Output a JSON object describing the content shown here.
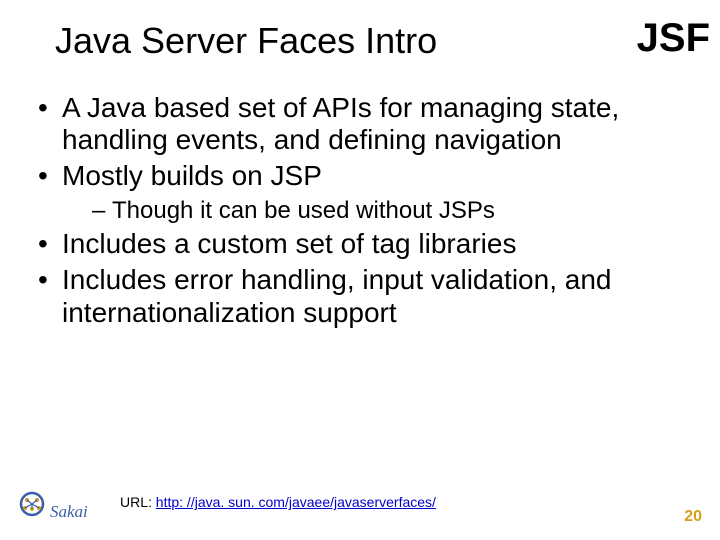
{
  "title": "Java Server Faces Intro",
  "corner_label": "JSF",
  "bullets": {
    "b0": "A Java based set of APIs for managing state, handling events, and defining navigation",
    "b1": "Mostly builds on JSP",
    "b1_sub0": "Though it can be used without JSPs",
    "b2": "Includes a custom set of tag libraries",
    "b3": "Includes error handling, input validation, and internationalization support"
  },
  "url": {
    "prefix": "URL: ",
    "text": "http: //java. sun. com/javaee/javaserverfaces/",
    "href": "http://java.sun.com/javaee/javaserverfaces/"
  },
  "page_number": "20",
  "logo": {
    "name": "Sakai"
  }
}
